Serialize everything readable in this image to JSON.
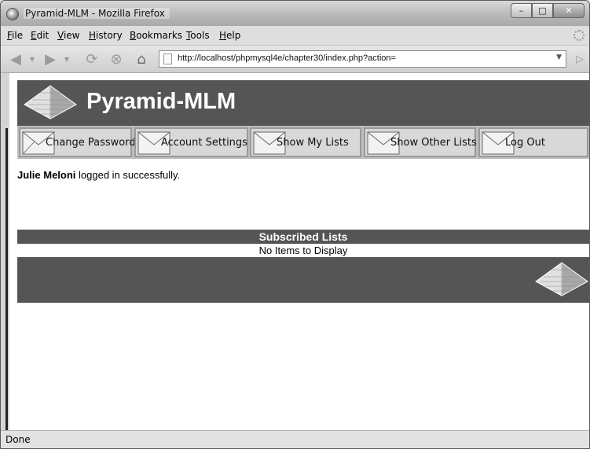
{
  "window": {
    "title": "Pyramid-MLM - Mozilla Firefox"
  },
  "menu": [
    "File",
    "Edit",
    "View",
    "History",
    "Bookmarks",
    "Tools",
    "Help"
  ],
  "address_bar": {
    "url": "http://localhost/phpmysql4e/chapter30/index.php?action="
  },
  "page": {
    "site_title": "Pyramid-MLM",
    "nav": [
      "Change Password",
      "Account Settings",
      "Show My Lists",
      "Show Other Lists",
      "Log Out"
    ],
    "message": {
      "user": "Julie Meloni",
      "text": " logged in successfully."
    },
    "lists": {
      "header": "Subscribed Lists",
      "empty_text": "No Items to Display"
    }
  },
  "status": {
    "text": "Done"
  }
}
